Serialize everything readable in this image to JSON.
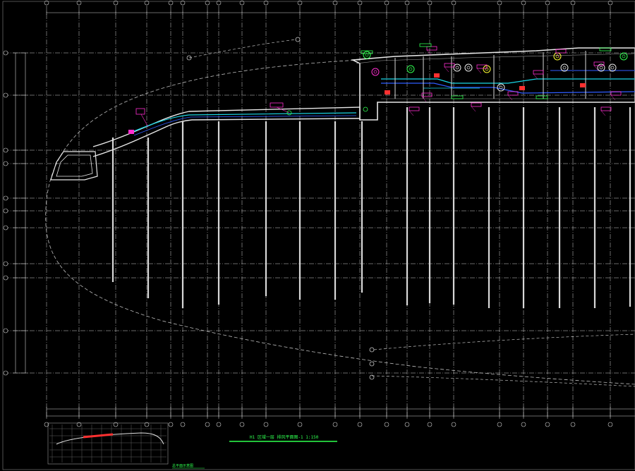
{
  "drawing": {
    "title": "H1 区域一层 排风平面图-1  1:150",
    "keyplan_label": "总平面示意图",
    "scale": "1:150"
  },
  "colors": {
    "background": "#000000",
    "grid": "#cfcfcf",
    "wall": "#e8e8e8",
    "duct_cyan": "#19d6e6",
    "duct_blue": "#2f5cff",
    "annotation_magenta": "#ff2fd0",
    "annotation_red": "#ff3030",
    "equipment_green": "#2fff4f",
    "equipment_yellow": "#ffff33",
    "title_underline": "#22c33a"
  },
  "grid_axes": {
    "vertical": [
      "1",
      "2",
      "3",
      "4",
      "5",
      "6",
      "7",
      "8",
      "9",
      "10",
      "11",
      "12",
      "13",
      "14",
      "15",
      "16",
      "17",
      "18",
      "19"
    ],
    "horizontal": [
      "A",
      "B",
      "C",
      "D",
      "E",
      "F",
      "G",
      "H",
      "J",
      "K"
    ]
  },
  "tags": {
    "tag_a": "P-1",
    "tag_b": "P-2",
    "tag_c": "P-3",
    "tag_d": "P-4"
  }
}
